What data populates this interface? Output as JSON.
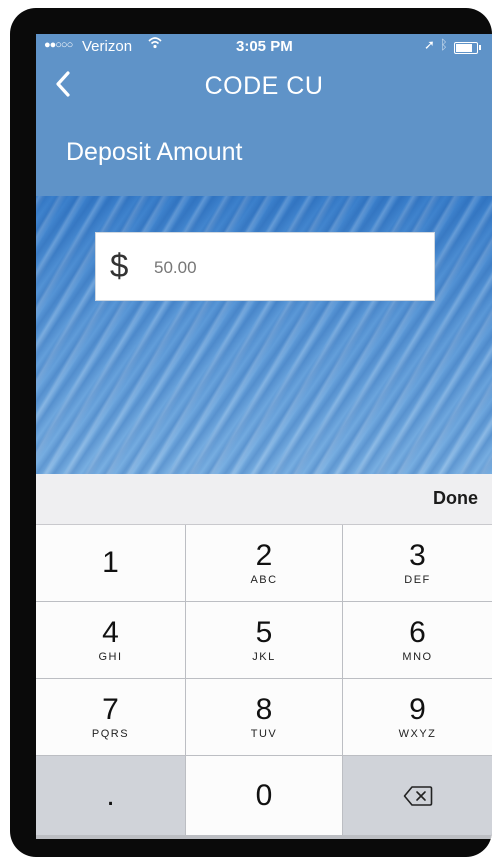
{
  "status_bar": {
    "signal": "●●○○○",
    "carrier": "Verizon",
    "time": "3:05 PM"
  },
  "nav": {
    "title": "CODE CU"
  },
  "section": {
    "title": "Deposit Amount"
  },
  "amount": {
    "currency_symbol": "$",
    "value": "50.00"
  },
  "accessory": {
    "done_label": "Done"
  },
  "keypad": {
    "keys": [
      {
        "num": "1",
        "letters": ""
      },
      {
        "num": "2",
        "letters": "ABC"
      },
      {
        "num": "3",
        "letters": "DEF"
      },
      {
        "num": "4",
        "letters": "GHI"
      },
      {
        "num": "5",
        "letters": "JKL"
      },
      {
        "num": "6",
        "letters": "MNO"
      },
      {
        "num": "7",
        "letters": "PQRS"
      },
      {
        "num": "8",
        "letters": "TUV"
      },
      {
        "num": "9",
        "letters": "WXYZ"
      },
      {
        "num": ".",
        "letters": ""
      },
      {
        "num": "0",
        "letters": ""
      }
    ]
  },
  "colors": {
    "header_blue": "#5f93c8"
  }
}
